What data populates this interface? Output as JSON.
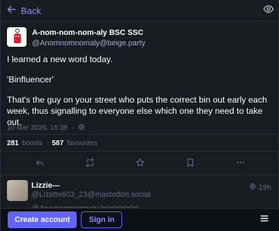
{
  "header": {
    "back_label": "Back"
  },
  "post": {
    "display_name": "A-nom-nom-nom-aly BSC SSC",
    "handle": "@Anomnomnomaly@beige.party",
    "paragraphs": [
      "I learned a new word today.",
      "'Binfluencer'",
      "That's the guy on your street who puts the correct bin out early each week, thus signalling to everyone else which one they need to take out."
    ],
    "timestamp": "10 Mar 2026, 15:38",
    "boosts_count": "281",
    "boosts_label": "boosts",
    "favourites_count": "587",
    "favourites_label": "favourites"
  },
  "reply": {
    "display_name": "Lizzie---",
    "handle": "@Lizette603_23@mastodon.social",
    "time": "19h",
    "preview_text": "@Anomnomnomaly lolololololol"
  },
  "bottombar": {
    "create_account_label": "Create account",
    "sign_in_label": "Sign in"
  },
  "colors": {
    "accent": "#6364ff",
    "accent_text": "#8c8dff",
    "muted": "#606984",
    "handle": "#9baec8",
    "background": "#191b22"
  },
  "icons": {
    "back": "arrow-left-icon",
    "visibility": "eye-icon",
    "public": "globe-icon",
    "reply": "reply-icon",
    "boost": "boost-icon",
    "favourite": "star-icon",
    "bookmark": "bookmark-icon",
    "more": "more-icon",
    "menu": "hamburger-icon"
  }
}
